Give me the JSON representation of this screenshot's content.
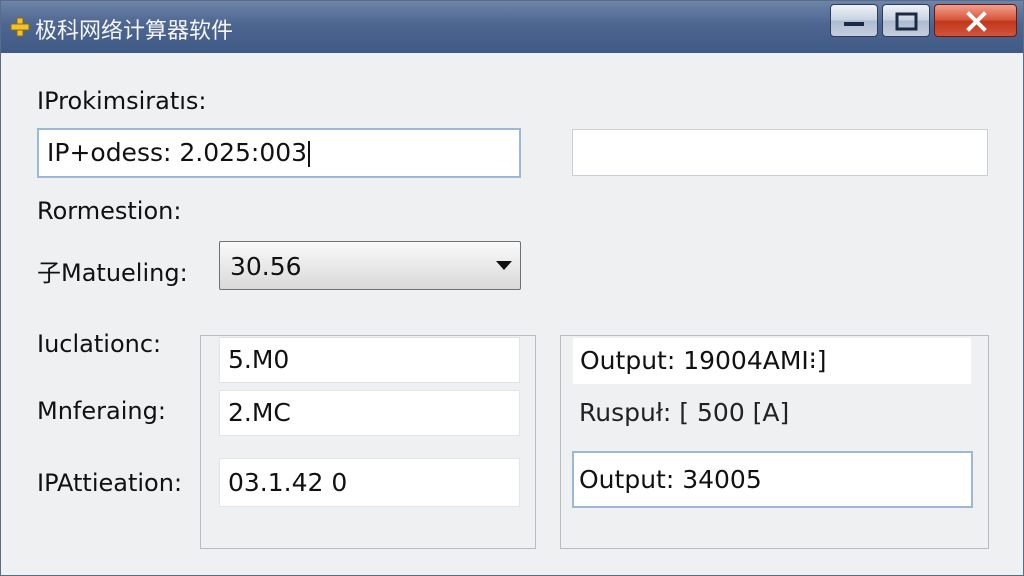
{
  "window": {
    "title": "极科网络计算器软件",
    "icon": "app-cross-icon"
  },
  "caption_buttons": {
    "minimize": "minimize-icon",
    "maximize": "maximize-icon",
    "close": "close-icon"
  },
  "form": {
    "ip_label": "IProkimsiratıs:",
    "ip_field_value": "IP+odess: 2.025:003",
    "ip_field2_value": "",
    "section_label": "Rormestion:",
    "matching_label": "子Matueling:",
    "matching_selected": "30.56",
    "calc_label": "Iuclationc:",
    "calc_value": "5.M0",
    "mnfering_label": "Mnferaing:",
    "mnfering_value": "2.MC",
    "attiation_label": "IPAttieation:",
    "attiation_value": "03.1.42 0"
  },
  "outputs": {
    "line1": "Output: 19004AMI⁝]",
    "line2": "Ruspuł: [ 500 [A]",
    "line3": "Output: 34005"
  },
  "colors": {
    "titlebar": "#4d6690",
    "close_button": "#c0381e",
    "focus_border": "#9cb8d6",
    "window_bg": "#eff0f2"
  }
}
